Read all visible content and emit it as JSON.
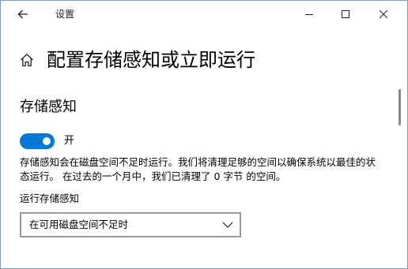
{
  "titlebar": {
    "title": "设置",
    "back_icon": "back-arrow-icon",
    "minimize_icon": "minimize-icon",
    "maximize_icon": "maximize-icon",
    "close_icon": "close-icon"
  },
  "header": {
    "home_icon": "home-icon",
    "title": "配置存储感知或立即运行"
  },
  "storage_sense": {
    "section_title": "存储感知",
    "toggle_state": "on",
    "toggle_label": "开",
    "description": "存储感知会在磁盘空间不足时运行。我们将清理足够的空间以确保系统以最佳的状态运行。 在过去的一个月中，我们已清理了 0 字节 的空间。",
    "run_label": "运行存储感知",
    "run_selected": "在可用磁盘空间不足时",
    "chevron_icon": "chevron-down-icon"
  },
  "colors": {
    "accent": "#0078d7",
    "window_border": "#7a9cc6",
    "dropdown_border": "#9a9a9a",
    "scrollbar": "#8a8a8a"
  }
}
